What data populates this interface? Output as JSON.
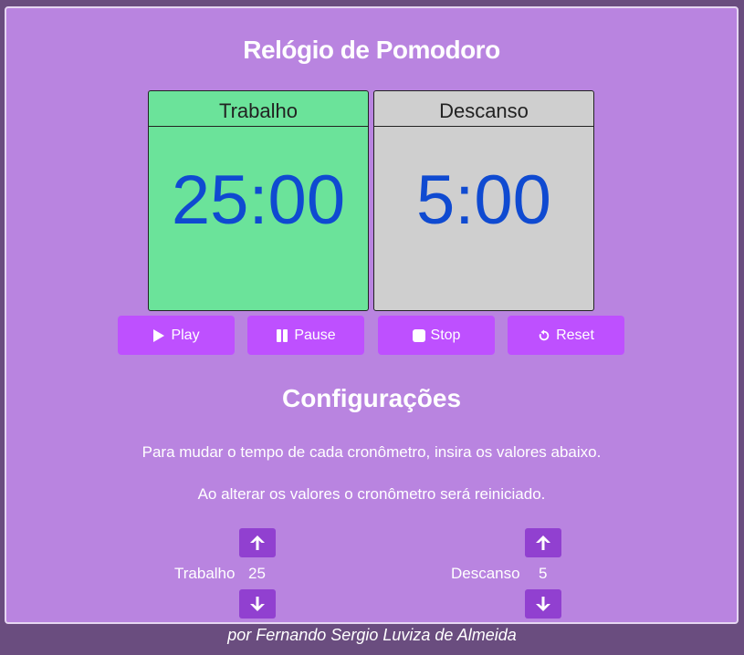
{
  "app": {
    "title": "Relógio de Pomodoro"
  },
  "timers": {
    "work": {
      "label": "Trabalho",
      "time": "25:00",
      "color": "#6be39a"
    },
    "rest": {
      "label": "Descanso",
      "time": "5:00",
      "color": "#cfcfcf"
    }
  },
  "controls": {
    "play": {
      "label": "Play",
      "icon": "play-icon"
    },
    "pause": {
      "label": "Pause",
      "icon": "pause-icon"
    },
    "stop": {
      "label": "Stop",
      "icon": "stop-icon"
    },
    "reset": {
      "label": "Reset",
      "icon": "reset-icon"
    },
    "color": "#be50ff"
  },
  "settings": {
    "title": "Configurações",
    "text1": "Para mudar o tempo de cada cronômetro, insira os valores abaixo.",
    "text2": "Ao alterar os valores o cronômetro será reiniciado.",
    "work": {
      "label": "Trabalho",
      "value": "25"
    },
    "rest": {
      "label": "Descanso",
      "value": "5"
    }
  },
  "footer": {
    "credit": "por Fernando Sergio Luviza de Almeida"
  }
}
